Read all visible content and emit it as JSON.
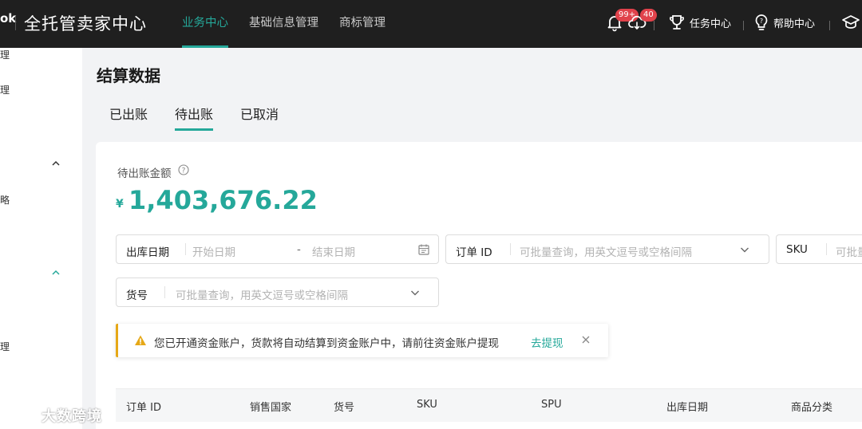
{
  "header": {
    "logo_fragment": "ok",
    "app_title": "全托管卖家中心",
    "nav": [
      "业务中心",
      "基础信息管理",
      "商标管理"
    ],
    "active_nav": "业务中心",
    "notifications_badge": "99+",
    "cloud_badge": "40",
    "task_center": "任务中心",
    "help_center": "帮助中心"
  },
  "sidebar": {
    "items": [
      "理",
      "理",
      "略",
      "理"
    ]
  },
  "page": {
    "title": "结算数据",
    "tabs": [
      "已出账",
      "待出账",
      "已取消"
    ],
    "active_tab": "待出账"
  },
  "summary": {
    "label": "待出账金额",
    "currency": "¥",
    "amount": "1,403,676.22"
  },
  "filters": {
    "ship_date": {
      "label": "出库日期",
      "start_placeholder": "开始日期",
      "dash": "-",
      "end_placeholder": "结束日期"
    },
    "order_id": {
      "label": "订单 ID",
      "placeholder": "可批量查询，用英文逗号或空格间隔"
    },
    "sku": {
      "label": "SKU",
      "placeholder": "可批量"
    },
    "item_no": {
      "label": "货号",
      "placeholder": "可批量查询，用英文逗号或空格间隔"
    }
  },
  "alert": {
    "text": "您已开通资金账户，货款将自动结算到资金账户中，请前往资金账户提现",
    "link": "去提现"
  },
  "table": {
    "columns": [
      "订单 ID",
      "销售国家",
      "货号",
      "SKU",
      "SPU",
      "出库日期",
      "商品分类"
    ]
  },
  "watermark": {
    "text": "大数跨境"
  },
  "colors": {
    "accent": "#25a89a",
    "warning": "#e6a817",
    "badge": "#e0424b",
    "topbar": "#1f1f1f"
  }
}
